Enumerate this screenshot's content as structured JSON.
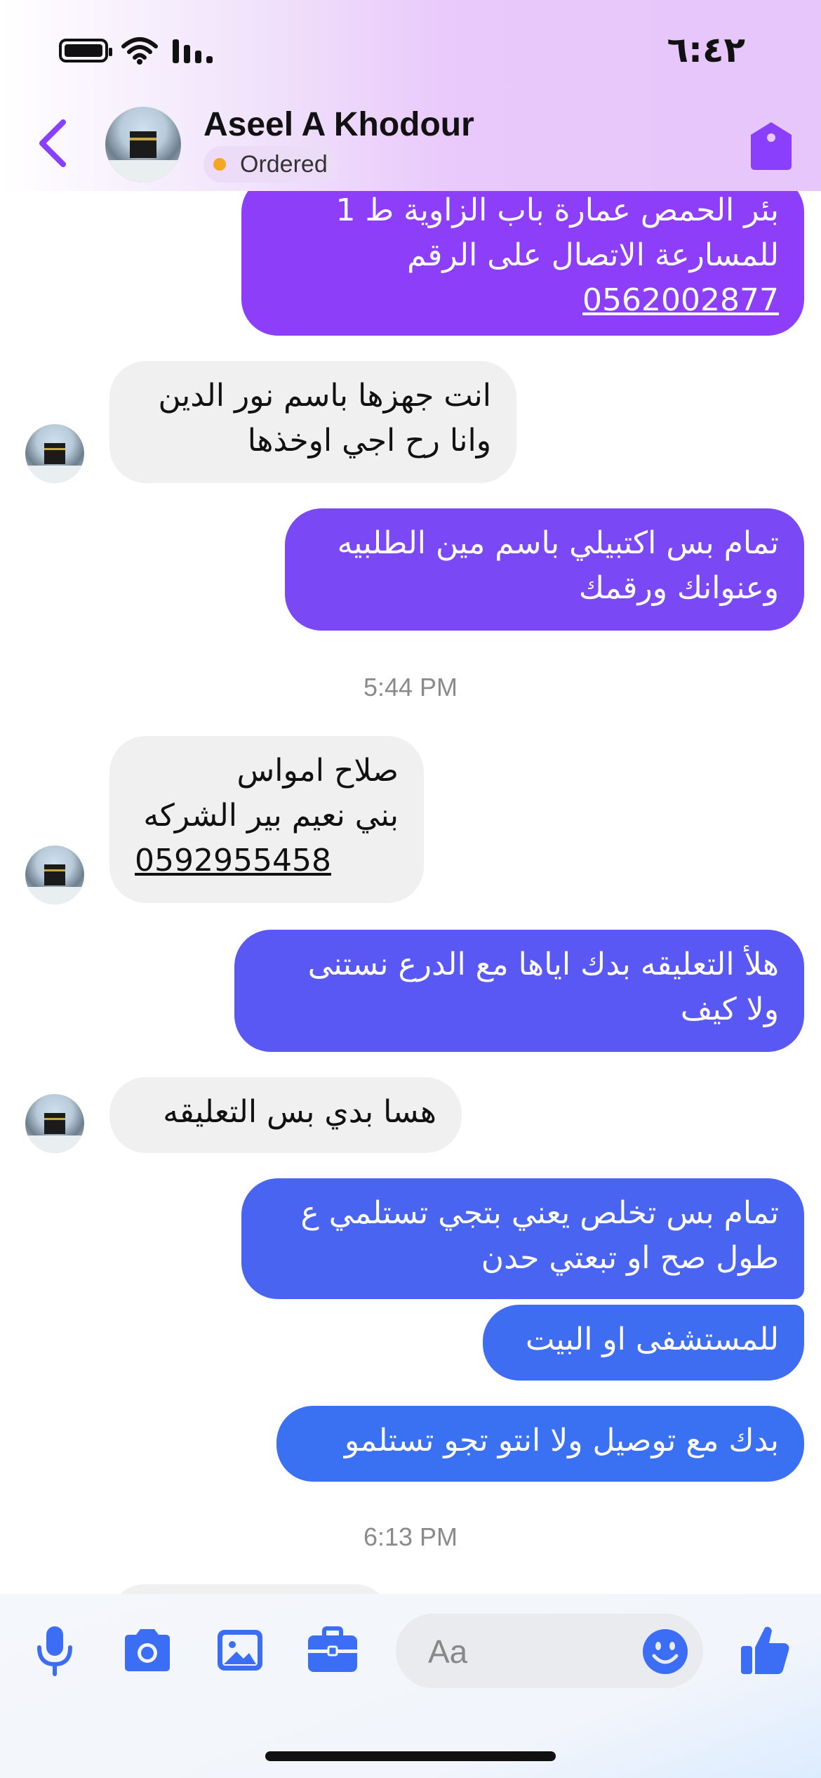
{
  "status_bar": {
    "time": "٦:٤٢"
  },
  "header": {
    "contact_name": "Aseel A Khodour",
    "order_status": "Ordered",
    "accent_color": "#8a3ffc"
  },
  "messages": [
    {
      "type": "sent",
      "lines": [
        "بئر الحمص عمارة باب الزاوية ط 1",
        "للمسارعة الاتصال على الرقم"
      ],
      "phone": "0562002877"
    },
    {
      "type": "received",
      "lines": [
        "انت جهزها باسم نور الدين",
        "وانا رح اجي اوخذها"
      ]
    },
    {
      "type": "sent",
      "lines": [
        "تمام بس اكتبيلي باسم مين الطلبيه",
        "وعنوانك ورقمك"
      ]
    },
    {
      "type": "timestamp",
      "text": "5:44 PM"
    },
    {
      "type": "received",
      "lines": [
        "صلاح امواس",
        "بني نعيم بير الشركه"
      ],
      "phone": "0592955458"
    },
    {
      "type": "sent",
      "lines": [
        "هلأ التعليقه بدك اياها مع الدرع نستنى",
        "ولا كيف"
      ]
    },
    {
      "type": "received",
      "lines": [
        "هسا بدي بس التعليقه"
      ]
    },
    {
      "type": "sent",
      "lines": [
        "تمام بس تخلص يعني بتجي تستلمي ع",
        "طول صح او تبعتي حدن"
      ]
    },
    {
      "type": "sent",
      "lines": [
        "للمستشفى او البيت"
      ]
    },
    {
      "type": "sent",
      "lines": [
        "بدك مع توصيل ولا انتو تجو تستلمو"
      ]
    },
    {
      "type": "timestamp",
      "text": "6:13 PM"
    }
  ],
  "composer": {
    "placeholder": "Aa",
    "tools": [
      "microphone-icon",
      "camera-icon",
      "photo-icon",
      "briefcase-icon"
    ],
    "icon_color": "#3b6ef5"
  }
}
